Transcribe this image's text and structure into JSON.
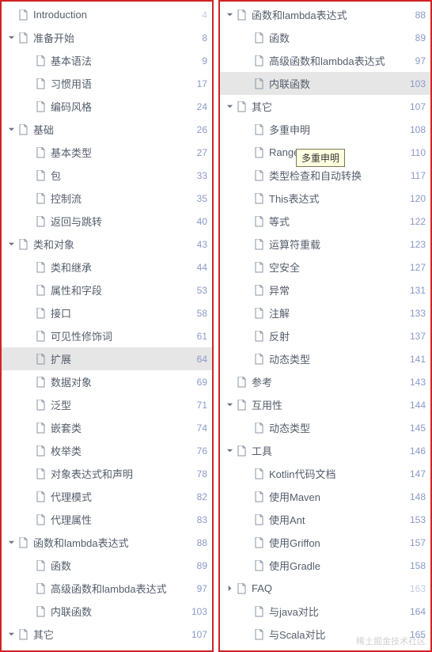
{
  "tooltip": "多重申明",
  "watermark": "稀土掘金技术社区",
  "left": [
    {
      "depth": 0,
      "arrow": null,
      "label": "Introduction",
      "page": 4,
      "faded": true
    },
    {
      "depth": 0,
      "arrow": "down",
      "label": "准备开始",
      "page": 8,
      "faded": false
    },
    {
      "depth": 1,
      "arrow": null,
      "label": "基本语法",
      "page": 9,
      "faded": false
    },
    {
      "depth": 1,
      "arrow": null,
      "label": "习惯用语",
      "page": 17,
      "faded": false
    },
    {
      "depth": 1,
      "arrow": null,
      "label": "编码风格",
      "page": 24,
      "faded": false
    },
    {
      "depth": 0,
      "arrow": "down",
      "label": "基础",
      "page": 26,
      "faded": false
    },
    {
      "depth": 1,
      "arrow": null,
      "label": "基本类型",
      "page": 27,
      "faded": false
    },
    {
      "depth": 1,
      "arrow": null,
      "label": "包",
      "page": 33,
      "faded": false
    },
    {
      "depth": 1,
      "arrow": null,
      "label": "控制流",
      "page": 35,
      "faded": false
    },
    {
      "depth": 1,
      "arrow": null,
      "label": "返回与跳转",
      "page": 40,
      "faded": false
    },
    {
      "depth": 0,
      "arrow": "down",
      "label": "类和对象",
      "page": 43,
      "faded": false
    },
    {
      "depth": 1,
      "arrow": null,
      "label": "类和继承",
      "page": 44,
      "faded": false
    },
    {
      "depth": 1,
      "arrow": null,
      "label": "属性和字段",
      "page": 53,
      "faded": false
    },
    {
      "depth": 1,
      "arrow": null,
      "label": "接口",
      "page": 58,
      "faded": false
    },
    {
      "depth": 1,
      "arrow": null,
      "label": "可见性修饰词",
      "page": 61,
      "faded": false
    },
    {
      "depth": 1,
      "arrow": null,
      "label": "扩展",
      "page": 64,
      "faded": false,
      "selected": true
    },
    {
      "depth": 1,
      "arrow": null,
      "label": "数据对象",
      "page": 69,
      "faded": false
    },
    {
      "depth": 1,
      "arrow": null,
      "label": "泛型",
      "page": 71,
      "faded": false
    },
    {
      "depth": 1,
      "arrow": null,
      "label": "嵌套类",
      "page": 74,
      "faded": false
    },
    {
      "depth": 1,
      "arrow": null,
      "label": "枚举类",
      "page": 76,
      "faded": false
    },
    {
      "depth": 1,
      "arrow": null,
      "label": "对象表达式和声明",
      "page": 78,
      "faded": false
    },
    {
      "depth": 1,
      "arrow": null,
      "label": "代理模式",
      "page": 82,
      "faded": false
    },
    {
      "depth": 1,
      "arrow": null,
      "label": "代理属性",
      "page": 83,
      "faded": false
    },
    {
      "depth": 0,
      "arrow": "down",
      "label": "函数和lambda表达式",
      "page": 88,
      "faded": false
    },
    {
      "depth": 1,
      "arrow": null,
      "label": "函数",
      "page": 89,
      "faded": false
    },
    {
      "depth": 1,
      "arrow": null,
      "label": "高级函数和lambda表达式",
      "page": 97,
      "faded": false
    },
    {
      "depth": 1,
      "arrow": null,
      "label": "内联函数",
      "page": 103,
      "faded": false
    },
    {
      "depth": 0,
      "arrow": "down",
      "label": "其它",
      "page": 107,
      "faded": false
    }
  ],
  "right": [
    {
      "depth": 0,
      "arrow": "down",
      "label": "函数和lambda表达式",
      "page": 88,
      "faded": false
    },
    {
      "depth": 1,
      "arrow": null,
      "label": "函数",
      "page": 89,
      "faded": false
    },
    {
      "depth": 1,
      "arrow": null,
      "label": "高级函数和lambda表达式",
      "page": 97,
      "faded": false
    },
    {
      "depth": 1,
      "arrow": null,
      "label": "内联函数",
      "page": 103,
      "faded": false,
      "selected": true
    },
    {
      "depth": 0,
      "arrow": "down",
      "label": "其它",
      "page": 107,
      "faded": false
    },
    {
      "depth": 1,
      "arrow": null,
      "label": "多重申明",
      "page": 108,
      "faded": false
    },
    {
      "depth": 1,
      "arrow": null,
      "label": "Ranges",
      "page": 110,
      "faded": false
    },
    {
      "depth": 1,
      "arrow": null,
      "label": "类型检查和自动转换",
      "page": 117,
      "faded": false
    },
    {
      "depth": 1,
      "arrow": null,
      "label": "This表达式",
      "page": 120,
      "faded": false
    },
    {
      "depth": 1,
      "arrow": null,
      "label": "等式",
      "page": 122,
      "faded": false
    },
    {
      "depth": 1,
      "arrow": null,
      "label": "运算符重载",
      "page": 123,
      "faded": false
    },
    {
      "depth": 1,
      "arrow": null,
      "label": "空安全",
      "page": 127,
      "faded": false
    },
    {
      "depth": 1,
      "arrow": null,
      "label": "异常",
      "page": 131,
      "faded": false
    },
    {
      "depth": 1,
      "arrow": null,
      "label": "注解",
      "page": 133,
      "faded": false
    },
    {
      "depth": 1,
      "arrow": null,
      "label": "反射",
      "page": 137,
      "faded": false
    },
    {
      "depth": 1,
      "arrow": null,
      "label": "动态类型",
      "page": 141,
      "faded": false
    },
    {
      "depth": 0,
      "arrow": null,
      "label": "参考",
      "page": 143,
      "faded": false
    },
    {
      "depth": 0,
      "arrow": "down",
      "label": "互用性",
      "page": 144,
      "faded": false
    },
    {
      "depth": 1,
      "arrow": null,
      "label": "动态类型",
      "page": 145,
      "faded": false
    },
    {
      "depth": 0,
      "arrow": "down",
      "label": "工具",
      "page": 146,
      "faded": false
    },
    {
      "depth": 1,
      "arrow": null,
      "label": "Kotlin代码文档",
      "page": 147,
      "faded": false
    },
    {
      "depth": 1,
      "arrow": null,
      "label": "使用Maven",
      "page": 148,
      "faded": false
    },
    {
      "depth": 1,
      "arrow": null,
      "label": "使用Ant",
      "page": 153,
      "faded": false
    },
    {
      "depth": 1,
      "arrow": null,
      "label": "使用Griffon",
      "page": 157,
      "faded": false
    },
    {
      "depth": 1,
      "arrow": null,
      "label": "使用Gradle",
      "page": 158,
      "faded": false
    },
    {
      "depth": 0,
      "arrow": "right",
      "label": "FAQ",
      "page": 163,
      "faded": true
    },
    {
      "depth": 1,
      "arrow": null,
      "label": "与java对比",
      "page": 164,
      "faded": false
    },
    {
      "depth": 1,
      "arrow": null,
      "label": "与Scala对比",
      "page": 165,
      "faded": false
    }
  ]
}
